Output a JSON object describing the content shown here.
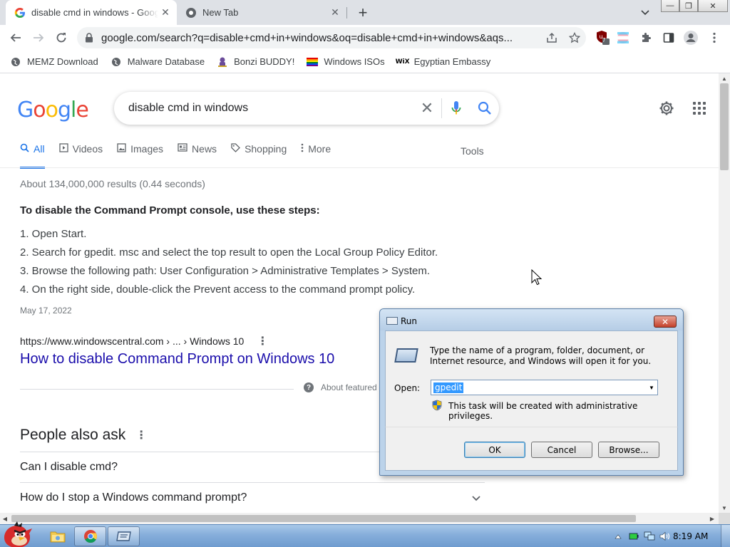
{
  "browser": {
    "tabs": [
      {
        "title": "disable cmd in windows - Google Search",
        "favicon": "google-g-icon",
        "active": true
      },
      {
        "title": "New Tab",
        "favicon": "chrome-globe-icon",
        "active": false
      }
    ],
    "new_tab_label": "+",
    "url": "google.com/search?q=disable+cmd+in+windows&oq=disable+cmd+in+windows&aqs...",
    "extension_badge": "7",
    "window_controls": {
      "minimize": "—",
      "restore": "❐",
      "close": "✕"
    }
  },
  "bookmarks": [
    {
      "label": "MEMZ Download",
      "icon": "globe-icon"
    },
    {
      "label": "Malware Database",
      "icon": "globe-icon"
    },
    {
      "label": "Bonzi BUDDY!",
      "icon": "bonzi-icon"
    },
    {
      "label": "Windows ISOs",
      "icon": "rainbow-flag-icon"
    },
    {
      "label": "Egyptian Embassy",
      "icon": "wix-icon"
    }
  ],
  "google": {
    "logo_letters": [
      {
        "ch": "G",
        "color": "#4285F4"
      },
      {
        "ch": "o",
        "color": "#EA4335"
      },
      {
        "ch": "o",
        "color": "#FBBC05"
      },
      {
        "ch": "g",
        "color": "#4285F4"
      },
      {
        "ch": "l",
        "color": "#34A853"
      },
      {
        "ch": "e",
        "color": "#EA4335"
      }
    ],
    "query": "disable cmd in windows",
    "nav_tabs": [
      {
        "label": "All",
        "icon": "search-icon",
        "active": true
      },
      {
        "label": "Videos",
        "icon": "video-icon"
      },
      {
        "label": "Images",
        "icon": "image-icon"
      },
      {
        "label": "News",
        "icon": "news-icon"
      },
      {
        "label": "Shopping",
        "icon": "tag-icon"
      },
      {
        "label": "More",
        "icon": "more-vert-icon"
      }
    ],
    "tools_label": "Tools",
    "result_stats": "About 134,000,000 results (0.44 seconds)",
    "snippet": {
      "heading": "To disable the Command Prompt console, use these steps:",
      "steps": [
        "1. Open Start.",
        "2. Search for gpedit. msc and select the top result to open the Local Group Policy Editor.",
        "3. Browse the following path: User Configuration > Administrative Templates > System.",
        "4. On the right side, double-click the Prevent access to the command prompt policy."
      ],
      "date": "May 17, 2022",
      "cite": "https://www.windowscentral.com › ... › Windows 10",
      "title": "How to disable Command Prompt on Windows 10",
      "about_featured": "About featured snippets"
    },
    "people_also_ask": {
      "heading": "People also ask",
      "questions": [
        "Can I disable cmd?",
        "How do I stop a Windows command prompt?"
      ]
    }
  },
  "run_dialog": {
    "title": "Run",
    "close_label": "✕",
    "description": "Type the name of a program, folder, document, or Internet resource, and Windows will open it for you.",
    "open_label": "Open:",
    "open_value": "gpedit",
    "admin_note": "This task will be created with administrative privileges.",
    "buttons": {
      "ok": "OK",
      "cancel": "Cancel",
      "browse": "Browse..."
    }
  },
  "taskbar": {
    "pinned": [
      {
        "name": "explorer",
        "icon": "folder-icon"
      },
      {
        "name": "chrome",
        "icon": "chrome-icon",
        "open": true
      },
      {
        "name": "run",
        "icon": "run-icon",
        "open": true
      }
    ],
    "clock": "8:19 AM"
  }
}
